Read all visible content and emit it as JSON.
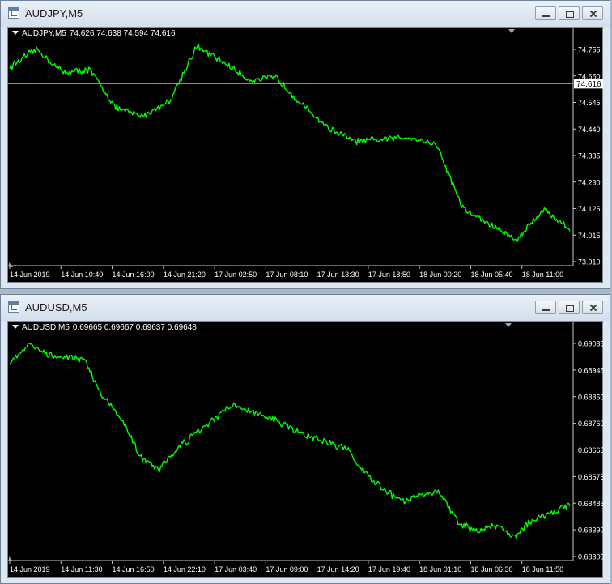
{
  "windows": [
    {
      "title": "AUDJPY,M5",
      "info": {
        "symbol": "AUDJPY,M5",
        "ohlc": "74.626 74.638 74.594 74.616"
      },
      "price_labels": [
        "74.755",
        "74.650",
        "74.545",
        "74.440",
        "74.335",
        "74.230",
        "74.125",
        "74.015",
        "73.910"
      ],
      "current_price": "74.616",
      "time_labels": [
        "14 Jun 2019",
        "14 Jun 10:40",
        "14 Jun 16:00",
        "14 Jun 21:20",
        "17 Jun 02:50",
        "17 Jun 08:10",
        "17 Jun 13:30",
        "17 Jun 18:50",
        "18 Jun 00:20",
        "18 Jun 05:40",
        "18 Jun 11:00"
      ]
    },
    {
      "title": "AUDUSD,M5",
      "info": {
        "symbol": "AUDUSD,M5",
        "ohlc": "0.69665 0.69667 0.69637 0.69648"
      },
      "price_labels": [
        "0.69035",
        "0.68945",
        "0.68850",
        "0.68760",
        "0.68665",
        "0.68575",
        "0.68485",
        "0.68390",
        "0.68300"
      ],
      "time_labels": [
        "14 Jun 2019",
        "14 Jun 11:30",
        "14 Jun 16:50",
        "14 Jun 22:10",
        "17 Jun 03:40",
        "17 Jun 09:00",
        "17 Jun 14:20",
        "17 Jun 19:40",
        "18 Jun 01:10",
        "18 Jun 06:30",
        "18 Jun 11:50"
      ]
    }
  ],
  "chart_data": [
    {
      "type": "line",
      "title": "AUDJPY,M5",
      "color": "#00ff00",
      "ylim": [
        73.91,
        74.79
      ],
      "current_price": 74.616,
      "x": [
        "14 Jun 2019",
        "14 Jun 10:40",
        "14 Jun 16:00",
        "14 Jun 21:20",
        "17 Jun 02:50",
        "17 Jun 08:10",
        "17 Jun 13:30",
        "17 Jun 18:50",
        "18 Jun 00:20",
        "18 Jun 05:40",
        "18 Jun 11:00"
      ],
      "series": [
        {
          "values": [
            74.68,
            74.75,
            74.66,
            74.67,
            74.52,
            74.49,
            74.55,
            74.76,
            74.7,
            74.63,
            74.64,
            74.53,
            74.44,
            74.39,
            74.4,
            74.41,
            74.38,
            74.13,
            74.07,
            74.01,
            74.13,
            74.05
          ]
        }
      ]
    },
    {
      "type": "line",
      "title": "AUDUSD,M5",
      "color": "#00ff00",
      "ylim": [
        68300,
        69070
      ],
      "series": [
        {
          "values": [
            68970,
            69030,
            69000,
            68990,
            68980,
            68850,
            68780,
            68650,
            68610,
            68680,
            68730,
            68780,
            68830,
            68800,
            68780,
            68750,
            68720,
            68700,
            68680,
            68600,
            68540,
            68500,
            68520,
            68535,
            68430,
            68400,
            68420,
            68380,
            68440,
            68460,
            68490
          ]
        }
      ]
    }
  ]
}
